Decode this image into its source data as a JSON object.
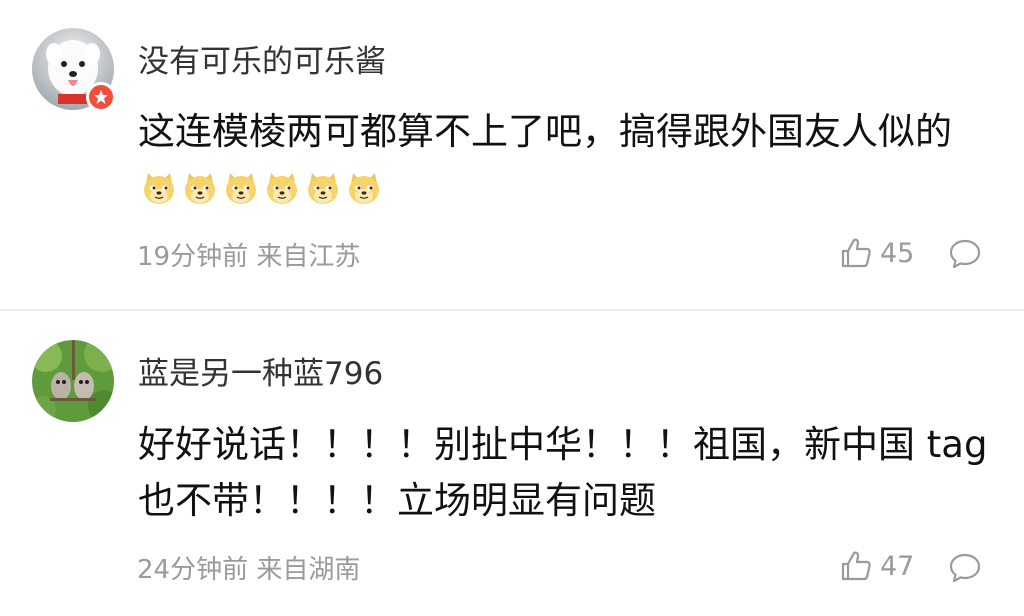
{
  "comments": [
    {
      "username": "没有可乐的可乐酱",
      "text": "这连模棱两可都算不上了吧，搞得跟外国友人似的",
      "emoji": "doge-emoji",
      "emoji_count": 6,
      "time": "19分钟前",
      "location": "来自江苏",
      "likes": "45",
      "verified": true,
      "badge_color": "#f24e3b"
    },
    {
      "username": "蓝是另一种蓝796",
      "text": "好好说话！！！！别扯中华！！！祖国，新中国 tag也不带！！！！立场明显有问题",
      "time": "24分钟前",
      "location": "来自湖南",
      "likes": "47"
    }
  ],
  "icons": {
    "like": "thumbs-up-icon",
    "reply": "comment-bubble-icon"
  }
}
